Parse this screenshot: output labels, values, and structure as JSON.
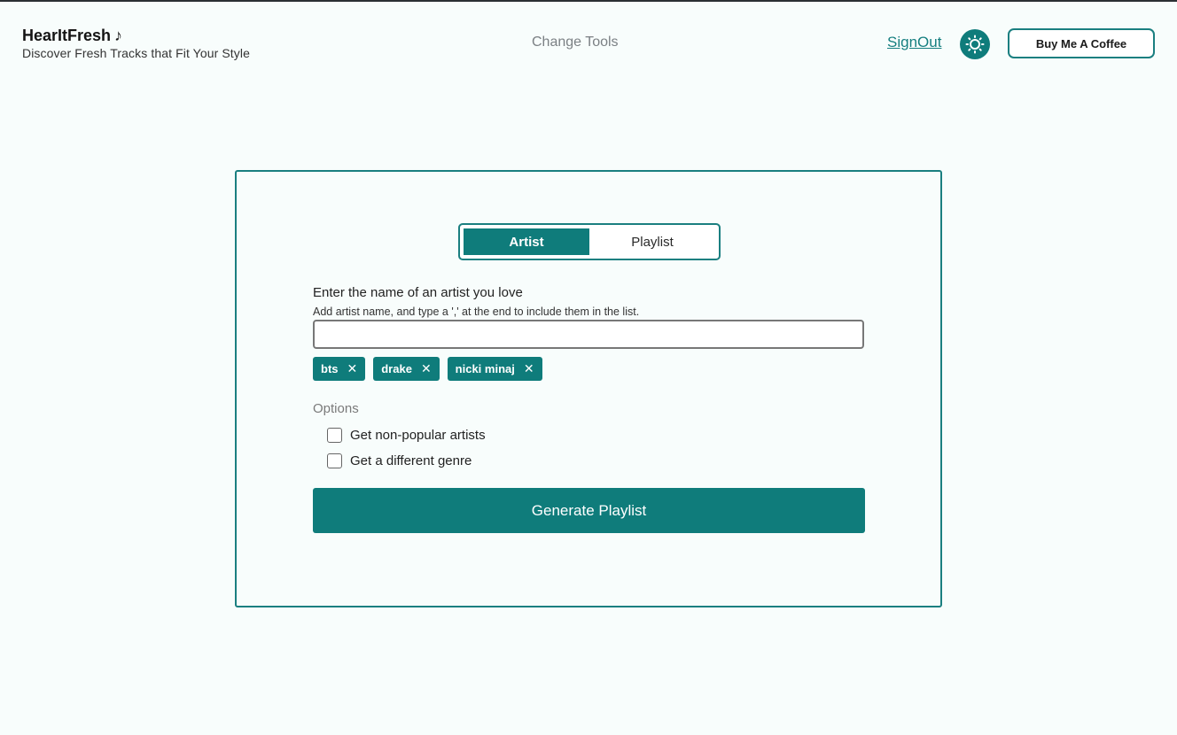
{
  "header": {
    "brand_title": "HearItFresh",
    "brand_icon": "music-note-icon",
    "brand_subtitle": "Discover Fresh Tracks that Fit Your Style",
    "nav_change_tools": "Change Tools",
    "signout_label": "SignOut",
    "theme_toggle_icon": "sun-icon",
    "coffee_label": "Buy Me A Coffee"
  },
  "form": {
    "mode_tabs": [
      {
        "label": "Artist",
        "active": true
      },
      {
        "label": "Playlist",
        "active": false
      }
    ],
    "artist_label": "Enter the name of an artist you love",
    "artist_hint": "Add artist name, and type a ',' at the end to include them in the list.",
    "artist_input_value": "",
    "artist_input_placeholder": "",
    "artists": [
      {
        "name": "bts"
      },
      {
        "name": "drake"
      },
      {
        "name": "nicki minaj"
      }
    ],
    "options_label": "Options",
    "options": [
      {
        "label": "Get non-popular artists",
        "checked": false
      },
      {
        "label": "Get a different genre",
        "checked": false
      }
    ],
    "generate_label": "Generate Playlist"
  },
  "colors": {
    "accent": "#0f7c7b",
    "background": "#f8fdfc"
  }
}
